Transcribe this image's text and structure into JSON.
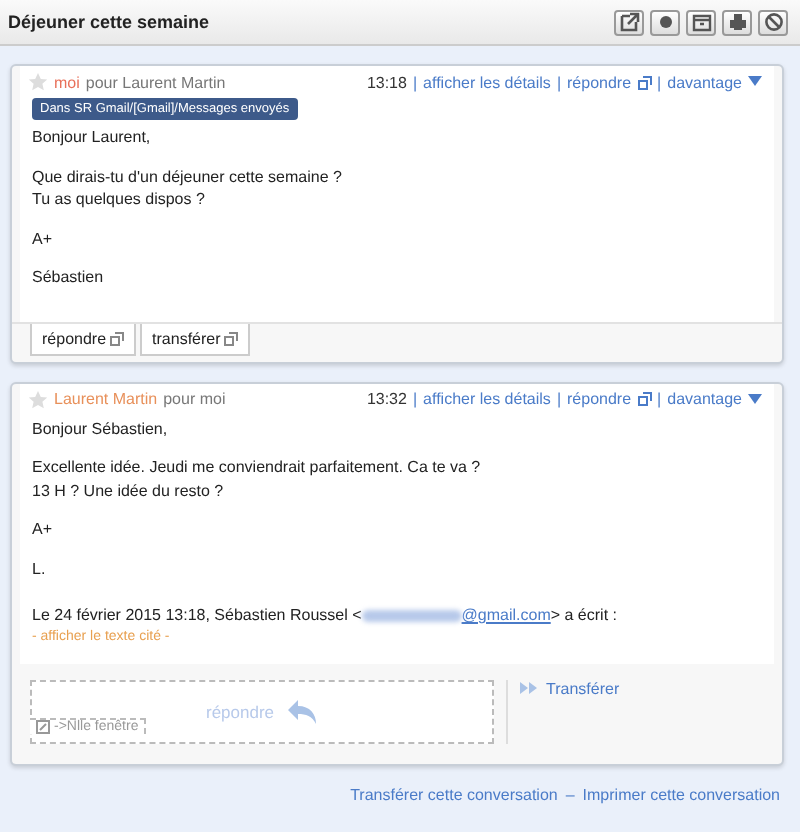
{
  "title": "Déjeuner cette semaine",
  "messages": [
    {
      "starred": false,
      "from": "moi",
      "to": "pour Laurent Martin",
      "time": "13:18",
      "separator": "|",
      "details": "afficher les détails",
      "reply": "répondre",
      "more": "davantage",
      "label": "Dans SR Gmail/[Gmail]/Messages envoyés",
      "paragraphs": [
        [
          "Bonjour Laurent,"
        ],
        [
          "Que dirais-tu d'un déjeuner cette semaine ?",
          "Tu as quelques dispos ?"
        ],
        [
          "A+"
        ],
        [
          "Sébastien"
        ]
      ],
      "actions": [
        "répondre",
        "transférer"
      ]
    },
    {
      "starred": false,
      "from": "Laurent Martin",
      "to": "pour moi",
      "time": "13:32",
      "separator": "|",
      "details": "afficher les détails",
      "reply": "répondre",
      "more": "davantage",
      "paragraphs": [
        [
          "Bonjour Sébastien,"
        ],
        [
          "Excellente idée. Jeudi me conviendrait parfaitement. Ca te va ?",
          "13 H ? Une idée du resto ?"
        ],
        [
          "A+"
        ],
        [
          "L."
        ]
      ],
      "quote": {
        "before": "Le 24 février 2015 13:18, Sébastien Roussel <",
        "email": "@gmail.com",
        "after": "> a écrit :",
        "show": "- afficher le texte cité -"
      },
      "compose": {
        "placeholder": "répondre",
        "new_window": "->Nlle fenêtre",
        "forward": "Transférer"
      }
    }
  ],
  "footer": {
    "forward": "Transférer cette conversation",
    "separator": "–",
    "print": "Imprimer cette conversation"
  }
}
